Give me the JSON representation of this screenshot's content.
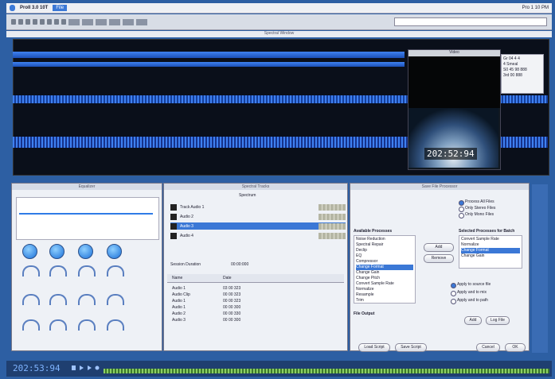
{
  "menubar": {
    "app_name": "ProII 3.0 10T",
    "file_menu": "File",
    "clock": "Pro 1 10 PM"
  },
  "spot_view": {
    "window_title": "Spectral Window",
    "timecode": "202:52:94"
  },
  "video_window": {
    "title": "Video"
  },
  "info_box": {
    "lines": [
      "Gr 04 4 4",
      "4 Smeal",
      "S0 45 98 888",
      "3rd 00 888"
    ]
  },
  "eq_panel": {
    "title": "Equalizer"
  },
  "track_panel": {
    "title": "Spectral Tracks",
    "header_label": "Spectrum",
    "session_duration_label": "Session Duration",
    "session_duration_value": "00:00:000",
    "tracks": [
      {
        "name": "Track Audio 1"
      },
      {
        "name": "Audio 2"
      },
      {
        "name": "Audio 3"
      },
      {
        "name": "Audio 4"
      }
    ],
    "list_columns": [
      "Name",
      "Date"
    ],
    "list_rows": [
      {
        "name": "Audio 1",
        "date": "03 00 323"
      },
      {
        "name": "Audio Clip",
        "date": "00 00 323"
      },
      {
        "name": "Audio 1",
        "date": "00 00 323"
      },
      {
        "name": "Audio 1",
        "date": "00 00 300"
      },
      {
        "name": "Audio 2",
        "date": "00 00 330"
      },
      {
        "name": "Audio 3",
        "date": "00 00 300"
      }
    ]
  },
  "file_panel": {
    "title": "Save File Processor",
    "options": [
      "Process All Files",
      "Only Stereo Files",
      "Only Mono Files"
    ],
    "available_label": "Available Processes",
    "processes": [
      "Noise Reduction",
      "Spectral Repair",
      "Declip",
      "EQ",
      "Compressor",
      "Change Format",
      "Change Gain",
      "Change Pitch",
      "Convert Sample Rate",
      "Normalize",
      "Resample",
      "Trim"
    ],
    "selected_process": "Change Format",
    "add_button": "Add",
    "remove_button": "Remove",
    "selected_label": "Selected Processes for Batch",
    "selected_items": [
      "Convert Sample Rate",
      "Normalize",
      "Change Format",
      "Change Gain"
    ],
    "dest_options": [
      "Apply to source file",
      "Apply and to mix",
      "Apply and to path"
    ],
    "output_label": "File Output",
    "add_button_2": "Add",
    "log_button": "Log File",
    "load_button": "Load Script",
    "save_button": "Save Script",
    "cancel_button": "Cancel",
    "ok_button": "OK"
  },
  "bottom": {
    "timecode": "202:53:94"
  }
}
